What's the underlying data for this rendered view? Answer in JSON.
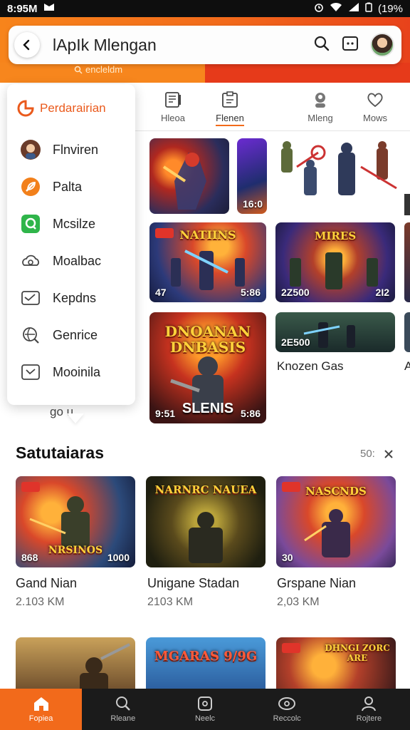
{
  "status": {
    "time": "8:95M",
    "battery": "(19%"
  },
  "header": {
    "search_text": "lApIk Mlengan",
    "hint": "encleldm"
  },
  "tabs": [
    {
      "label": "Hleoa",
      "icon": "book-icon"
    },
    {
      "label": "Flenen",
      "icon": "clipboard-icon"
    },
    {
      "label": "Mleng",
      "icon": "person-icon"
    },
    {
      "label": "Mows",
      "icon": "heart-icon"
    }
  ],
  "menu": {
    "title": "Perdarairian",
    "items": [
      {
        "label": "Flnviren",
        "icon": "avatar-icon"
      },
      {
        "label": "Palta",
        "icon": "leaf-icon"
      },
      {
        "label": "Mcsilze",
        "icon": "chat-icon"
      },
      {
        "label": "Moalbac",
        "icon": "cloud-icon"
      },
      {
        "label": "Kepdns",
        "icon": "mail-icon"
      },
      {
        "label": "Genrice",
        "icon": "search-globe-icon"
      },
      {
        "label": "Mooinila",
        "icon": "box-icon"
      }
    ],
    "footer": "go u"
  },
  "featured": {
    "t1": {
      "badge": ""
    },
    "t2": {
      "badge": "16:0"
    },
    "t3": {
      "badge_l": "47",
      "badge_r": "5:86",
      "title": "NATIINS"
    },
    "t4": {
      "badge_l": "2Z500",
      "badge_r": "2I2",
      "title": "MIRES"
    },
    "t5": {
      "badge_l": "9:51",
      "badge_r": "5:86",
      "title": "DNOANAN DNBASIS",
      "sub": "SLENIS"
    },
    "t6": {
      "badge_l": "2E500",
      "caption": "Knozen Gas"
    },
    "side_letter": "A"
  },
  "section": {
    "title": "Satutaiaras",
    "more": "50:"
  },
  "cards": [
    {
      "title_art": "NRSINOS",
      "badge_l": "868",
      "badge_r": "1000",
      "name": "Gand Nian",
      "size": "2.103 KM"
    },
    {
      "title_art": "NARNRC NAUEA",
      "badge_l": "",
      "badge_r": "",
      "name": "Unigane Stadan",
      "size": "2103 KM"
    },
    {
      "title_art": "NASCNDS",
      "badge_l": "30",
      "badge_r": "",
      "name": "Grspane Nian",
      "size": "2,03 KM"
    }
  ],
  "row3": [
    {
      "title_art": ""
    },
    {
      "title_art": "MGARAS 9/9G"
    },
    {
      "title_art": "DHNGI ZORC ARE"
    }
  ],
  "bottom_nav": [
    {
      "label": "Fopiea",
      "icon": "home-icon",
      "active": true
    },
    {
      "label": "Rleane",
      "icon": "search-icon",
      "active": false
    },
    {
      "label": "Neelc",
      "icon": "app-icon",
      "active": false
    },
    {
      "label": "Reccolc",
      "icon": "controller-icon",
      "active": false
    },
    {
      "label": "Rojtere",
      "icon": "profile-icon",
      "active": false
    }
  ],
  "colors": {
    "brand": "#f26a1b",
    "accent": "#e63a1a"
  }
}
